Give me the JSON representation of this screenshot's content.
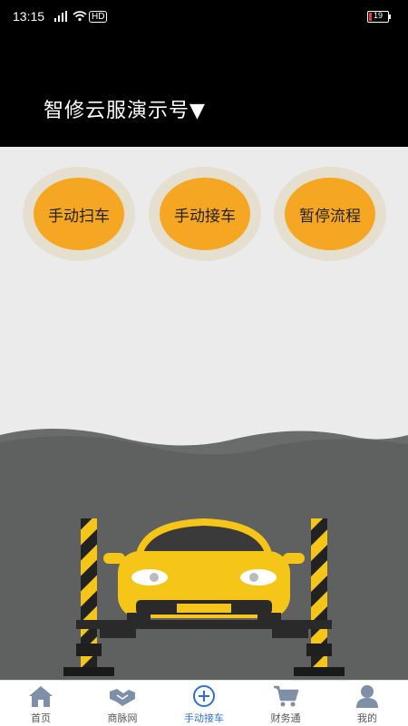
{
  "status_bar": {
    "time": "13:15",
    "hd_label": "HD",
    "battery": "19",
    "battery_color": "#e53935"
  },
  "header": {
    "title": "智修云服演示号▼"
  },
  "actions": [
    {
      "label": "手动扫车"
    },
    {
      "label": "手动接车"
    },
    {
      "label": "暂停流程"
    }
  ],
  "colors": {
    "accent": "#f5a623",
    "nav_active": "#2f6fd0",
    "car": "#f5c518"
  },
  "nav": {
    "items": [
      {
        "label": "首页",
        "icon": "home-icon"
      },
      {
        "label": "商脉网",
        "icon": "handshake-icon"
      },
      {
        "label": "手动接车",
        "icon": "plus-circle-icon",
        "active": true
      },
      {
        "label": "财务通",
        "icon": "cart-icon"
      },
      {
        "label": "我的",
        "icon": "person-icon"
      }
    ]
  }
}
